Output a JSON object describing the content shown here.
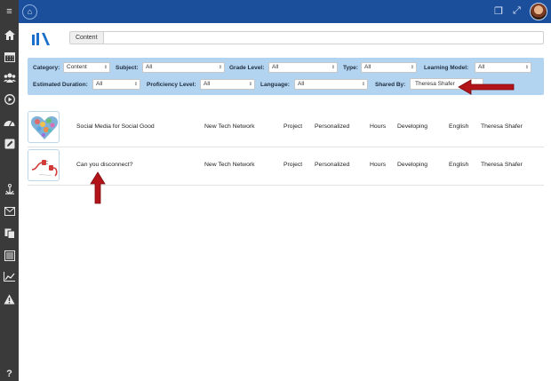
{
  "top_icons": {
    "home": "home-icon",
    "copy": "copy-icon",
    "expand": "expand-icon"
  },
  "sidebar": {
    "items": [
      "menu-icon",
      "home-icon",
      "calendar-icon",
      "users-icon",
      "play-icon",
      "dashboard-icon",
      "edit-icon",
      "anchor-icon",
      "mail-icon",
      "copy-icon",
      "list-icon",
      "chart-icon",
      "warning-icon",
      "help-icon"
    ],
    "menu_glyph": "≡",
    "help_glyph": "?"
  },
  "search": {
    "label": "Content",
    "value": ""
  },
  "filters": {
    "category": {
      "label": "Category:",
      "value": "Content"
    },
    "subject": {
      "label": "Subject:",
      "value": "All"
    },
    "grade_level": {
      "label": "Grade Level:",
      "value": "All"
    },
    "type": {
      "label": "Type:",
      "value": "All"
    },
    "learning_model": {
      "label": "Learning Model:",
      "value": "All"
    },
    "estimated_duration": {
      "label": "Estimated Duration:",
      "value": "All"
    },
    "proficiency_level": {
      "label": "Proficiency Level:",
      "value": "All"
    },
    "language": {
      "label": "Language:",
      "value": "All"
    },
    "shared_by": {
      "label": "Shared By:",
      "value": "Theresa Shafer"
    }
  },
  "results": [
    {
      "title": "Social Media for Social Good",
      "network": "New Tech Network",
      "type": "Project",
      "model": "Personalized",
      "duration": "Hours",
      "proficiency": "Developing",
      "language": "English",
      "shared_by": "Theresa Shafer"
    },
    {
      "title": "Can you disconnect?",
      "network": "New Tech Network",
      "type": "Project",
      "model": "Personalized",
      "duration": "Hours",
      "proficiency": "Developing",
      "language": "English",
      "shared_by": "Theresa Shafer"
    }
  ],
  "colors": {
    "topbar": "#1b4f9c",
    "sidebar": "#3a3a3a",
    "filter_bg": "#b3d4f0",
    "annotation": "#b3141a"
  }
}
